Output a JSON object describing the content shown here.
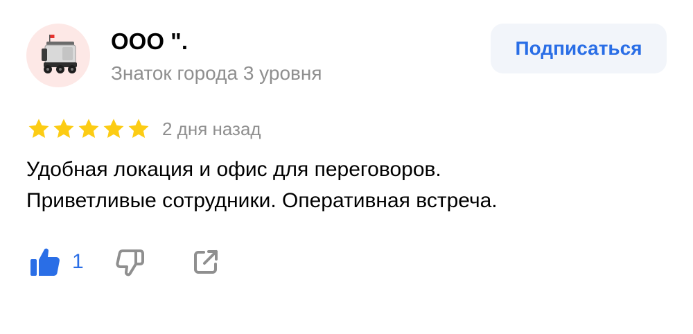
{
  "author": {
    "name": "ООО \".",
    "level": "Знаток города 3 уровня",
    "avatar_icon": "delivery-robot-icon"
  },
  "subscribe": {
    "label": "Подписаться"
  },
  "review": {
    "rating": 5,
    "rating_max": 5,
    "date": "2 дня назад",
    "text_line1": "Удобная локация и офис для переговоров.",
    "text_line2": "Приветливые сотрудники. Оперативная встреча."
  },
  "actions": {
    "like_icon": "thumbs-up-icon",
    "like_count": "1",
    "dislike_icon": "thumbs-down-icon",
    "share_icon": "share-icon"
  },
  "colors": {
    "accent": "#2a6ee6",
    "star": "#fccc14",
    "secondary_text": "#8f8f8f",
    "button_bg": "#f2f5fa",
    "avatar_bg": "#fde8e6"
  }
}
